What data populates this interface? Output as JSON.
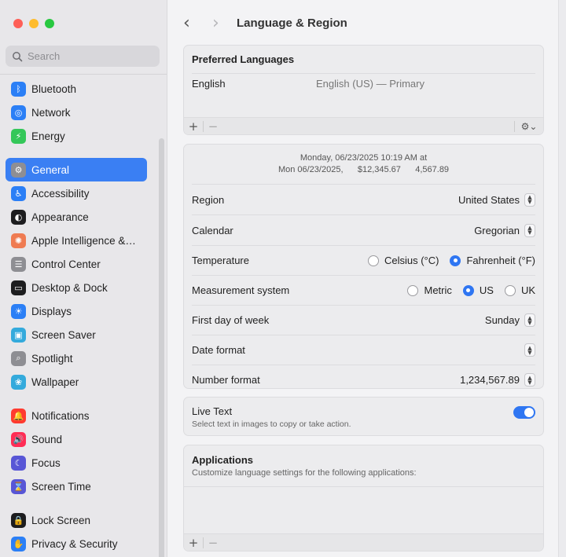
{
  "window": {
    "title": "Language & Region"
  },
  "search": {
    "placeholder": "Search"
  },
  "sidebar": {
    "items": [
      {
        "label": "Bluetooth",
        "icon": "bluetooth-icon",
        "color": "#2b7ff6",
        "glyph": "ᛒ"
      },
      {
        "label": "Network",
        "icon": "globe-icon",
        "color": "#2b7ff6",
        "glyph": "◎"
      },
      {
        "label": "Energy",
        "icon": "bolt-icon",
        "color": "#34c759",
        "glyph": "⚡"
      },
      {
        "label": "General",
        "icon": "gear-icon",
        "color": "#8e8e93",
        "glyph": "⚙",
        "active": true
      },
      {
        "label": "Accessibility",
        "icon": "accessibility-icon",
        "color": "#2b7ff6",
        "glyph": "♿"
      },
      {
        "label": "Appearance",
        "icon": "appearance-icon",
        "color": "#1d1d1f",
        "glyph": "◐"
      },
      {
        "label": "Apple Intelligence &…",
        "icon": "apple-intelligence-icon",
        "color": "#ef7b52",
        "glyph": "✺"
      },
      {
        "label": "Control Center",
        "icon": "control-center-icon",
        "color": "#8e8e93",
        "glyph": "☰"
      },
      {
        "label": "Desktop & Dock",
        "icon": "dock-icon",
        "color": "#1d1d1f",
        "glyph": "▭"
      },
      {
        "label": "Displays",
        "icon": "sun-icon",
        "color": "#2b7ff6",
        "glyph": "☀"
      },
      {
        "label": "Screen Saver",
        "icon": "screen-saver-icon",
        "color": "#34aadc",
        "glyph": "▣"
      },
      {
        "label": "Spotlight",
        "icon": "magnifier-icon",
        "color": "#8e8e93",
        "glyph": "⌕"
      },
      {
        "label": "Wallpaper",
        "icon": "wallpaper-icon",
        "color": "#34aadc",
        "glyph": "❀"
      },
      {
        "label": "Notifications",
        "icon": "bell-icon",
        "color": "#ff3b30",
        "glyph": "🔔"
      },
      {
        "label": "Sound",
        "icon": "speaker-icon",
        "color": "#ff2d55",
        "glyph": "🔊"
      },
      {
        "label": "Focus",
        "icon": "moon-icon",
        "color": "#5856d6",
        "glyph": "☾"
      },
      {
        "label": "Screen Time",
        "icon": "hourglass-icon",
        "color": "#5856d6",
        "glyph": "⌛"
      },
      {
        "label": "Lock Screen",
        "icon": "lock-icon",
        "color": "#1d1d1f",
        "glyph": "🔒"
      },
      {
        "label": "Privacy & Security",
        "icon": "hand-icon",
        "color": "#2b7ff6",
        "glyph": "✋"
      }
    ]
  },
  "preferred": {
    "title": "Preferred Languages",
    "language": "English",
    "language_detail": "English (US) — Primary",
    "add": "+",
    "remove": "−"
  },
  "formats": {
    "preview_line1": "Monday, 06/23/2025 10:19 AM at",
    "preview_line2": "Mon 06/23/2025,      $12,345.67      4,567.89",
    "region_label": "Region",
    "region_value": "United States",
    "calendar_label": "Calendar",
    "calendar_value": "Gregorian",
    "temperature_label": "Temperature",
    "celsius": "Celsius (°C)",
    "fahrenheit": "Fahrenheit (°F)",
    "measurement_label": "Measurement system",
    "metric": "Metric",
    "us": "US",
    "uk": "UK",
    "first_day_label": "First day of week",
    "first_day_value": "Sunday",
    "date_format_label": "Date format",
    "number_format_label": "Number format",
    "number_format_value": "1,234,567.89"
  },
  "live_text": {
    "title": "Live Text",
    "description": "Select text in images to copy or take action.",
    "enabled": true
  },
  "applications": {
    "title": "Applications",
    "description": "Customize language settings for the following applications:",
    "add": "+",
    "remove": "−"
  },
  "colors": {
    "accent": "#2f76f2"
  }
}
